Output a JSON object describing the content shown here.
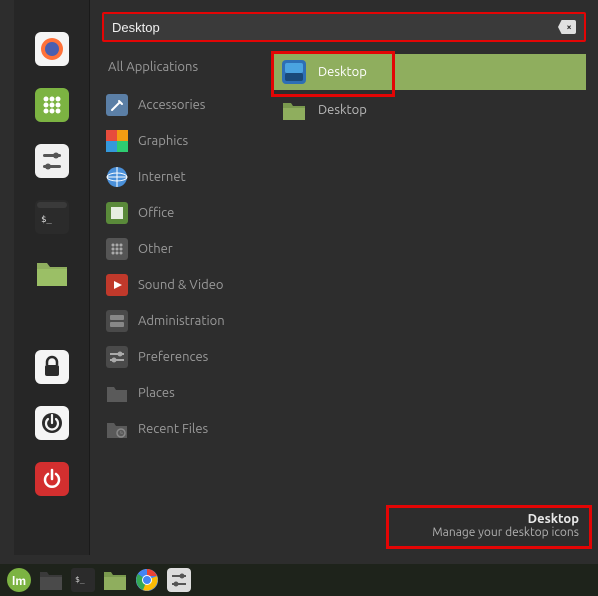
{
  "search": {
    "value": "Desktop",
    "clear_glyph": "×"
  },
  "categories": {
    "all": "All Applications",
    "items": [
      {
        "label": "Accessories"
      },
      {
        "label": "Graphics"
      },
      {
        "label": "Internet"
      },
      {
        "label": "Office"
      },
      {
        "label": "Other"
      },
      {
        "label": "Sound & Video"
      },
      {
        "label": "Administration"
      },
      {
        "label": "Preferences"
      },
      {
        "label": "Places"
      },
      {
        "label": "Recent Files"
      }
    ]
  },
  "results": [
    {
      "label": "Desktop",
      "selected": true
    },
    {
      "label": "Desktop",
      "selected": false
    }
  ],
  "footer": {
    "title": "Desktop",
    "desc": "Manage your desktop icons"
  },
  "favorites": [
    {
      "name": "firefox"
    },
    {
      "name": "software"
    },
    {
      "name": "settings"
    },
    {
      "name": "terminal"
    },
    {
      "name": "files"
    },
    {
      "name": "lock"
    },
    {
      "name": "logout"
    },
    {
      "name": "power"
    }
  ],
  "taskbar": [
    {
      "name": "menu"
    },
    {
      "name": "files"
    },
    {
      "name": "terminal"
    },
    {
      "name": "files2"
    },
    {
      "name": "chrome"
    },
    {
      "name": "settings"
    }
  ],
  "colors": {
    "accent": "#8fae5e",
    "highlight_box": "#e30505",
    "bg": "#2d2d2d",
    "panel": "#262626"
  }
}
